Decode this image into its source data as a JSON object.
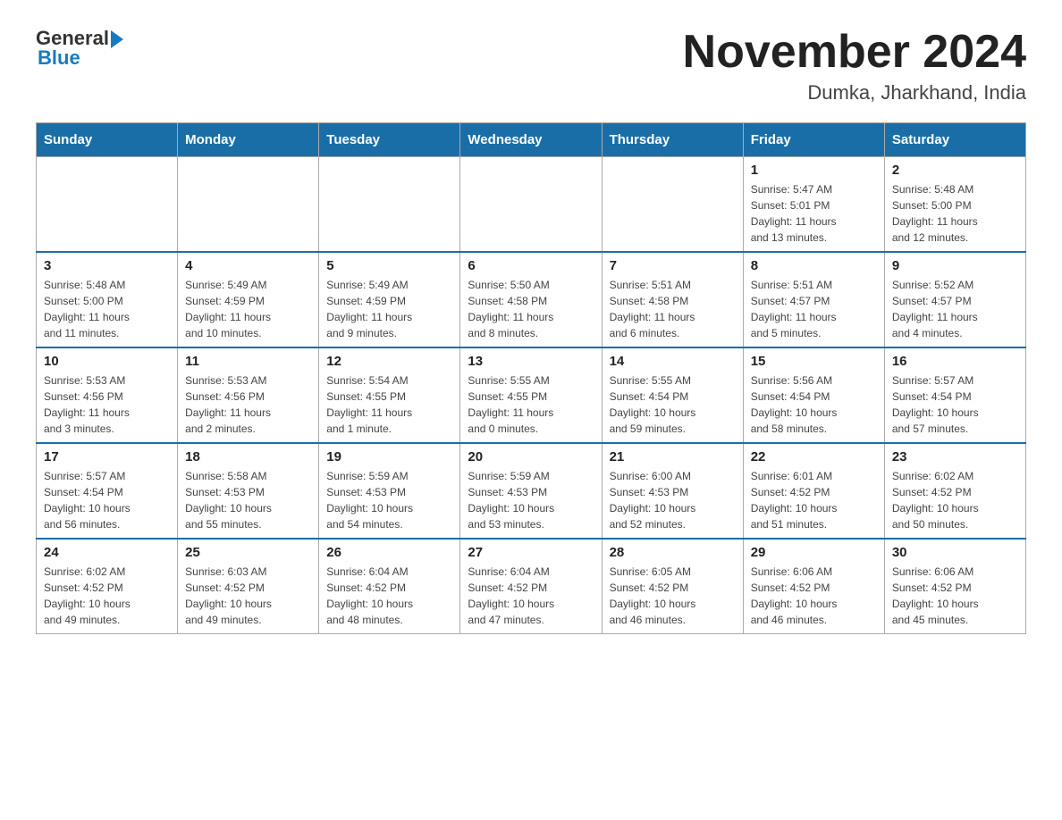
{
  "header": {
    "logo_text_general": "General",
    "logo_text_blue": "Blue",
    "month_year": "November 2024",
    "location": "Dumka, Jharkhand, India"
  },
  "days_of_week": [
    "Sunday",
    "Monday",
    "Tuesday",
    "Wednesday",
    "Thursday",
    "Friday",
    "Saturday"
  ],
  "weeks": [
    [
      {
        "day": "",
        "info": ""
      },
      {
        "day": "",
        "info": ""
      },
      {
        "day": "",
        "info": ""
      },
      {
        "day": "",
        "info": ""
      },
      {
        "day": "",
        "info": ""
      },
      {
        "day": "1",
        "info": "Sunrise: 5:47 AM\nSunset: 5:01 PM\nDaylight: 11 hours\nand 13 minutes."
      },
      {
        "day": "2",
        "info": "Sunrise: 5:48 AM\nSunset: 5:00 PM\nDaylight: 11 hours\nand 12 minutes."
      }
    ],
    [
      {
        "day": "3",
        "info": "Sunrise: 5:48 AM\nSunset: 5:00 PM\nDaylight: 11 hours\nand 11 minutes."
      },
      {
        "day": "4",
        "info": "Sunrise: 5:49 AM\nSunset: 4:59 PM\nDaylight: 11 hours\nand 10 minutes."
      },
      {
        "day": "5",
        "info": "Sunrise: 5:49 AM\nSunset: 4:59 PM\nDaylight: 11 hours\nand 9 minutes."
      },
      {
        "day": "6",
        "info": "Sunrise: 5:50 AM\nSunset: 4:58 PM\nDaylight: 11 hours\nand 8 minutes."
      },
      {
        "day": "7",
        "info": "Sunrise: 5:51 AM\nSunset: 4:58 PM\nDaylight: 11 hours\nand 6 minutes."
      },
      {
        "day": "8",
        "info": "Sunrise: 5:51 AM\nSunset: 4:57 PM\nDaylight: 11 hours\nand 5 minutes."
      },
      {
        "day": "9",
        "info": "Sunrise: 5:52 AM\nSunset: 4:57 PM\nDaylight: 11 hours\nand 4 minutes."
      }
    ],
    [
      {
        "day": "10",
        "info": "Sunrise: 5:53 AM\nSunset: 4:56 PM\nDaylight: 11 hours\nand 3 minutes."
      },
      {
        "day": "11",
        "info": "Sunrise: 5:53 AM\nSunset: 4:56 PM\nDaylight: 11 hours\nand 2 minutes."
      },
      {
        "day": "12",
        "info": "Sunrise: 5:54 AM\nSunset: 4:55 PM\nDaylight: 11 hours\nand 1 minute."
      },
      {
        "day": "13",
        "info": "Sunrise: 5:55 AM\nSunset: 4:55 PM\nDaylight: 11 hours\nand 0 minutes."
      },
      {
        "day": "14",
        "info": "Sunrise: 5:55 AM\nSunset: 4:54 PM\nDaylight: 10 hours\nand 59 minutes."
      },
      {
        "day": "15",
        "info": "Sunrise: 5:56 AM\nSunset: 4:54 PM\nDaylight: 10 hours\nand 58 minutes."
      },
      {
        "day": "16",
        "info": "Sunrise: 5:57 AM\nSunset: 4:54 PM\nDaylight: 10 hours\nand 57 minutes."
      }
    ],
    [
      {
        "day": "17",
        "info": "Sunrise: 5:57 AM\nSunset: 4:54 PM\nDaylight: 10 hours\nand 56 minutes."
      },
      {
        "day": "18",
        "info": "Sunrise: 5:58 AM\nSunset: 4:53 PM\nDaylight: 10 hours\nand 55 minutes."
      },
      {
        "day": "19",
        "info": "Sunrise: 5:59 AM\nSunset: 4:53 PM\nDaylight: 10 hours\nand 54 minutes."
      },
      {
        "day": "20",
        "info": "Sunrise: 5:59 AM\nSunset: 4:53 PM\nDaylight: 10 hours\nand 53 minutes."
      },
      {
        "day": "21",
        "info": "Sunrise: 6:00 AM\nSunset: 4:53 PM\nDaylight: 10 hours\nand 52 minutes."
      },
      {
        "day": "22",
        "info": "Sunrise: 6:01 AM\nSunset: 4:52 PM\nDaylight: 10 hours\nand 51 minutes."
      },
      {
        "day": "23",
        "info": "Sunrise: 6:02 AM\nSunset: 4:52 PM\nDaylight: 10 hours\nand 50 minutes."
      }
    ],
    [
      {
        "day": "24",
        "info": "Sunrise: 6:02 AM\nSunset: 4:52 PM\nDaylight: 10 hours\nand 49 minutes."
      },
      {
        "day": "25",
        "info": "Sunrise: 6:03 AM\nSunset: 4:52 PM\nDaylight: 10 hours\nand 49 minutes."
      },
      {
        "day": "26",
        "info": "Sunrise: 6:04 AM\nSunset: 4:52 PM\nDaylight: 10 hours\nand 48 minutes."
      },
      {
        "day": "27",
        "info": "Sunrise: 6:04 AM\nSunset: 4:52 PM\nDaylight: 10 hours\nand 47 minutes."
      },
      {
        "day": "28",
        "info": "Sunrise: 6:05 AM\nSunset: 4:52 PM\nDaylight: 10 hours\nand 46 minutes."
      },
      {
        "day": "29",
        "info": "Sunrise: 6:06 AM\nSunset: 4:52 PM\nDaylight: 10 hours\nand 46 minutes."
      },
      {
        "day": "30",
        "info": "Sunrise: 6:06 AM\nSunset: 4:52 PM\nDaylight: 10 hours\nand 45 minutes."
      }
    ]
  ]
}
